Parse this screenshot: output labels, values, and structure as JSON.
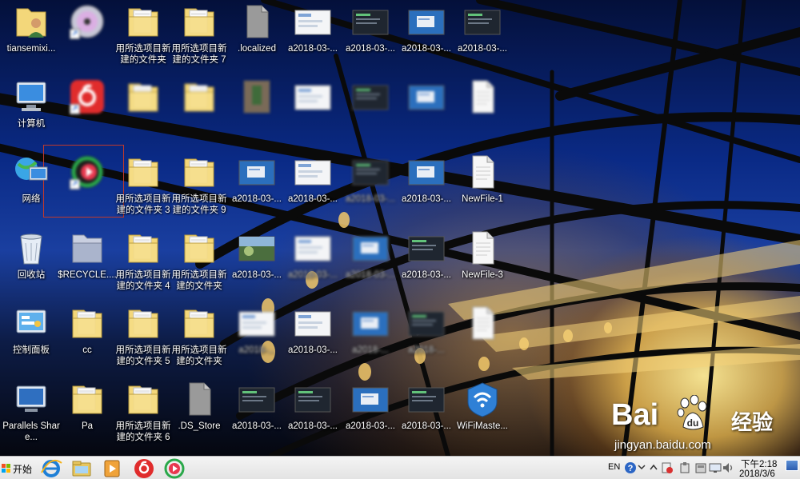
{
  "desktop": {
    "icons": [
      {
        "id": "user-folder",
        "label": "tiansemixi...",
        "kind": "user",
        "blur": false
      },
      {
        "id": "dvd-drive",
        "label": "",
        "kind": "dvd",
        "blur": true
      },
      {
        "id": "folder-r1c3",
        "label": "用所选项目新建的文件夹",
        "kind": "folder",
        "blur": false
      },
      {
        "id": "folder-7",
        "label": "用所选项目新建的文件夹 7",
        "kind": "folder",
        "blur": false
      },
      {
        "id": "localized",
        "label": ".localized",
        "kind": "file-gray",
        "blur": false
      },
      {
        "id": "shot-r1c6",
        "label": "a2018-03-...",
        "kind": "shot-light",
        "blur": false
      },
      {
        "id": "shot-r1c7",
        "label": "a2018-03-...",
        "kind": "shot-dark",
        "blur": false
      },
      {
        "id": "shot-r1c8",
        "label": "a2018-03-...",
        "kind": "shot-blue",
        "blur": false
      },
      {
        "id": "shot-r1c9",
        "label": "a2018-03-...",
        "kind": "shot-dark",
        "blur": false
      },
      {
        "id": "computer",
        "label": "计算机",
        "kind": "computer",
        "blur": false
      },
      {
        "id": "netease-music",
        "label": "",
        "kind": "netease",
        "blur": true
      },
      {
        "id": "folder-r2c3",
        "label": "",
        "kind": "folder",
        "blur": true
      },
      {
        "id": "folder-r2c4",
        "label": "",
        "kind": "folder",
        "blur": true
      },
      {
        "id": "photo-r2c5",
        "label": "",
        "kind": "photo",
        "blur": true
      },
      {
        "id": "shot-r2c6",
        "label": "",
        "kind": "shot-light",
        "blur": true
      },
      {
        "id": "shot-r2c7",
        "label": "",
        "kind": "shot-dark",
        "blur": true
      },
      {
        "id": "shot-r2c8",
        "label": "",
        "kind": "shot-blue",
        "blur": true
      },
      {
        "id": "file-r2c9",
        "label": "",
        "kind": "file-white",
        "blur": true
      },
      {
        "id": "network",
        "label": "网络",
        "kind": "network",
        "blur": false
      },
      {
        "id": "video-player",
        "label": "",
        "kind": "player",
        "blur": true
      },
      {
        "id": "folder-3",
        "label": "用所选项目新建的文件夹 3",
        "kind": "folder",
        "blur": false
      },
      {
        "id": "folder-9",
        "label": "用所选项目新建的文件夹 9",
        "kind": "folder",
        "blur": false
      },
      {
        "id": "shot-r3c5",
        "label": "a2018-03-...",
        "kind": "shot-blue",
        "blur": false
      },
      {
        "id": "shot-r3c6",
        "label": "a2018-03-...",
        "kind": "shot-light",
        "blur": false
      },
      {
        "id": "shot-r3c7",
        "label": "a2018-03-...",
        "kind": "shot-dark",
        "blur": true
      },
      {
        "id": "shot-r3c8",
        "label": "a2018-03-...",
        "kind": "shot-blue",
        "blur": false
      },
      {
        "id": "newfile-1",
        "label": "NewFile-1",
        "kind": "file-white",
        "blur": false
      },
      {
        "id": "recycle-bin",
        "label": "回收站",
        "kind": "recycle",
        "blur": false
      },
      {
        "id": "recycle-folder",
        "label": "$RECYCLE....",
        "kind": "recycle-folder",
        "blur": false
      },
      {
        "id": "folder-4",
        "label": "用所选项目新建的文件夹 4",
        "kind": "folder",
        "blur": false
      },
      {
        "id": "folder-8",
        "label": "用所选项目新建的文件夹",
        "kind": "folder",
        "blur": false
      },
      {
        "id": "shot-r4c5",
        "label": "a2018-03-...",
        "kind": "shot-photo",
        "blur": false
      },
      {
        "id": "shot-r4c6",
        "label": "a2018-03-...",
        "kind": "shot-light",
        "blur": true
      },
      {
        "id": "shot-r4c7",
        "label": "a2018-03-...",
        "kind": "shot-blue",
        "blur": true
      },
      {
        "id": "shot-r4c8",
        "label": "a2018-03-...",
        "kind": "shot-dark",
        "blur": false
      },
      {
        "id": "newfile-3",
        "label": "NewFile-3",
        "kind": "file-white",
        "blur": false
      },
      {
        "id": "control-panel",
        "label": "控制面板",
        "kind": "control",
        "blur": false
      },
      {
        "id": "cc-folder",
        "label": "cc",
        "kind": "folder",
        "blur": false
      },
      {
        "id": "folder-5",
        "label": "用所选项目新建的文件夹 5",
        "kind": "folder",
        "blur": false
      },
      {
        "id": "folder-10",
        "label": "用所选项目新建的文件夹",
        "kind": "folder",
        "blur": false
      },
      {
        "id": "shot-r5c5",
        "label": "a2018-...",
        "kind": "shot-light",
        "blur": true
      },
      {
        "id": "shot-r5c6",
        "label": "a2018-03-...",
        "kind": "shot-light",
        "blur": false
      },
      {
        "id": "shot-r5c7",
        "label": "a2018-...",
        "kind": "shot-blue",
        "blur": true
      },
      {
        "id": "shot-r5c8",
        "label": "a2018-...",
        "kind": "shot-dark",
        "blur": true
      },
      {
        "id": "app-r5c9",
        "label": "",
        "kind": "file-white",
        "blur": true
      },
      {
        "id": "parallels",
        "label": "Parallels Share...",
        "kind": "parallels",
        "blur": false
      },
      {
        "id": "pa-folder",
        "label": "Pa",
        "kind": "folder",
        "blur": false
      },
      {
        "id": "folder-6",
        "label": "用所选项目新建的文件夹 6",
        "kind": "folder",
        "blur": false
      },
      {
        "id": "ds-store",
        "label": ".DS_Store",
        "kind": "file-gray",
        "blur": false
      },
      {
        "id": "shot-r6c5",
        "label": "a2018-03-...",
        "kind": "shot-dark",
        "blur": false
      },
      {
        "id": "shot-r6c6",
        "label": "a2018-03-...",
        "kind": "shot-dark",
        "blur": false
      },
      {
        "id": "shot-r6c7",
        "label": "a2018-03-...",
        "kind": "shot-blue",
        "blur": false
      },
      {
        "id": "shot-r6c8",
        "label": "a2018-03-...",
        "kind": "shot-dark",
        "blur": false
      },
      {
        "id": "wifi-master",
        "label": "WiFiMaste...",
        "kind": "wifi",
        "blur": false
      }
    ]
  },
  "watermark": {
    "brand_left": "Bai",
    "brand_right": "经验",
    "url": "jingyan.baidu.com"
  },
  "taskbar": {
    "start_label": "开始",
    "pinned": [
      {
        "id": "ie",
        "icon": "ie-icon"
      },
      {
        "id": "explorer",
        "icon": "folder-icon"
      },
      {
        "id": "media-player",
        "icon": "media-player-icon"
      },
      {
        "id": "netease-music",
        "icon": "netease-music-icon"
      },
      {
        "id": "video-player",
        "icon": "video-player-icon"
      }
    ],
    "tray": {
      "language": "EN",
      "time": "下午2:18",
      "date": "2018/3/6"
    }
  },
  "colors": {
    "folder_yellow": "#f3d77a",
    "selection_border": "#c0392b",
    "netease_red": "#e02c2c",
    "player_green": "#2aa84a"
  }
}
